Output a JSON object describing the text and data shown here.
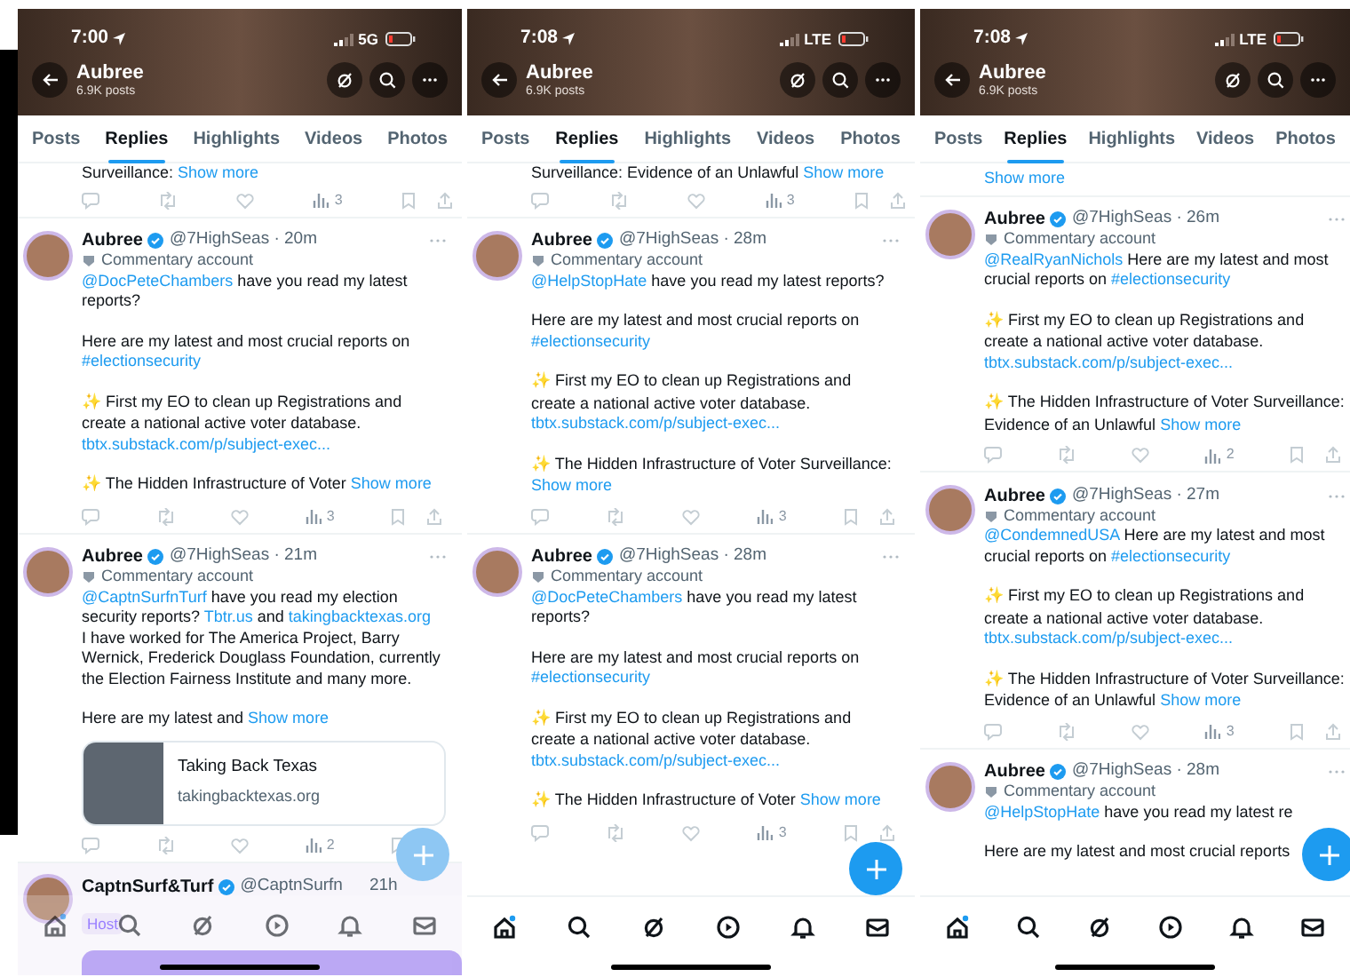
{
  "panels": [
    {
      "status": {
        "time": "7:00",
        "network": "5G"
      },
      "header": {
        "name": "Aubree",
        "posts": "6.9K posts"
      },
      "tabs": [
        {
          "label": "Posts",
          "selected": false
        },
        {
          "label": "Replies",
          "selected": true
        },
        {
          "label": "Highlights",
          "selected": false
        },
        {
          "label": "Videos",
          "selected": false
        },
        {
          "label": "Photos",
          "selected": false
        }
      ],
      "fragment": {
        "runs": [
          {
            "kind": "plain",
            "text": "Surveillance: "
          },
          {
            "kind": "more",
            "text": "Show more"
          }
        ],
        "views": "3"
      },
      "tweets": [
        {
          "name": "Aubree",
          "meta": "@7HighSeas · 20m",
          "label": "Commentary account",
          "paragraphs": [
            [
              {
                "kind": "mention",
                "text": "@DocPeteChambers"
              },
              {
                "kind": "plain",
                "text": " have you read my latest reports?"
              }
            ],
            [
              {
                "kind": "plain",
                "text": "Here are my latest and most crucial reports on "
              },
              {
                "kind": "hashtag",
                "text": "#electionsecurity"
              }
            ],
            [
              {
                "kind": "emoji",
                "text": "✨"
              },
              {
                "kind": "plain",
                "text": " First my EO to clean up Registrations and create a national active voter database. "
              },
              {
                "kind": "url",
                "text": "tbtx.substack.com/p/subject-exec..."
              }
            ],
            [
              {
                "kind": "emoji",
                "text": "✨"
              },
              {
                "kind": "plain",
                "text": " The Hidden Infrastructure of Voter "
              },
              {
                "kind": "more",
                "text": "Show more"
              }
            ]
          ],
          "views": "3"
        },
        {
          "name": "Aubree",
          "meta": "@7HighSeas · 21m",
          "label": "Commentary account",
          "paragraphs": [
            [
              {
                "kind": "mention",
                "text": "@CaptnSurfnTurf"
              },
              {
                "kind": "plain",
                "text": " have you read my election security reports? "
              },
              {
                "kind": "url",
                "text": "Tbtr.us"
              },
              {
                "kind": "plain",
                "text": " and "
              },
              {
                "kind": "url",
                "text": "takingbacktexas.org"
              },
              {
                "kind": "plain",
                "text": "\nI have worked for The America Project, Barry Wernick, Frederick Douglass Foundation, currently the Election Fairness Institute and many more."
              }
            ],
            [
              {
                "kind": "plain",
                "text": "Here are my latest and "
              },
              {
                "kind": "more",
                "text": "Show more"
              }
            ]
          ],
          "card": {
            "title": "Taking Back Texas",
            "domain": "takingbacktexas.org"
          },
          "views": "2"
        }
      ],
      "host_preview": {
        "name": "CaptnSurf&Turf",
        "meta": "@CaptnSurfn",
        "time": "21h",
        "badge": "Host"
      },
      "nav_translucent": true
    },
    {
      "status": {
        "time": "7:08",
        "network": "LTE"
      },
      "header": {
        "name": "Aubree",
        "posts": "6.9K posts"
      },
      "tabs": [
        {
          "label": "Posts",
          "selected": false
        },
        {
          "label": "Replies",
          "selected": true
        },
        {
          "label": "Highlights",
          "selected": false
        },
        {
          "label": "Videos",
          "selected": false
        },
        {
          "label": "Photos",
          "selected": false
        }
      ],
      "fragment": {
        "runs": [
          {
            "kind": "plain",
            "text": "Surveillance: Evidence of an Unlawful "
          },
          {
            "kind": "more",
            "text": "Show more"
          }
        ],
        "views": "3"
      },
      "tweets": [
        {
          "name": "Aubree",
          "meta": "@7HighSeas · 28m",
          "label": "Commentary account",
          "paragraphs": [
            [
              {
                "kind": "mention",
                "text": "@HelpStopHate"
              },
              {
                "kind": "plain",
                "text": " have you read my latest reports?"
              }
            ],
            [
              {
                "kind": "plain",
                "text": "Here are my latest and most crucial reports on "
              },
              {
                "kind": "hashtag",
                "text": "#electionsecurity"
              }
            ],
            [
              {
                "kind": "emoji",
                "text": "✨"
              },
              {
                "kind": "plain",
                "text": " First my EO to clean up Registrations and create a national active voter database. "
              },
              {
                "kind": "url",
                "text": "tbtx.substack.com/p/subject-exec..."
              }
            ],
            [
              {
                "kind": "emoji",
                "text": "✨"
              },
              {
                "kind": "plain",
                "text": " The Hidden Infrastructure of Voter Surveillance: "
              },
              {
                "kind": "more",
                "text": "Show more"
              }
            ]
          ],
          "views": "3"
        },
        {
          "name": "Aubree",
          "meta": "@7HighSeas · 28m",
          "label": "Commentary account",
          "paragraphs": [
            [
              {
                "kind": "mention",
                "text": "@DocPeteChambers"
              },
              {
                "kind": "plain",
                "text": " have you read my latest reports?"
              }
            ],
            [
              {
                "kind": "plain",
                "text": "Here are my latest and most crucial reports on "
              },
              {
                "kind": "hashtag",
                "text": "#electionsecurity"
              }
            ],
            [
              {
                "kind": "emoji",
                "text": "✨"
              },
              {
                "kind": "plain",
                "text": " First my EO to clean up Registrations and create a national active voter database. "
              },
              {
                "kind": "url",
                "text": "tbtx.substack.com/p/subject-exec..."
              }
            ],
            [
              {
                "kind": "emoji",
                "text": "✨"
              },
              {
                "kind": "plain",
                "text": " The Hidden Infrastructure of Voter "
              },
              {
                "kind": "more",
                "text": "Show more"
              }
            ]
          ],
          "views": "3"
        }
      ],
      "nav_translucent": false
    },
    {
      "status": {
        "time": "7:08",
        "network": "LTE"
      },
      "header": {
        "name": "Aubree",
        "posts": "6.9K posts"
      },
      "tabs": [
        {
          "label": "Posts",
          "selected": false
        },
        {
          "label": "Replies",
          "selected": true
        },
        {
          "label": "Highlights",
          "selected": false
        },
        {
          "label": "Videos",
          "selected": false
        },
        {
          "label": "Photos",
          "selected": false
        }
      ],
      "fragment": {
        "runs": [
          {
            "kind": "more",
            "text": "Show more"
          }
        ]
      },
      "tweets": [
        {
          "name": "Aubree",
          "meta": "@7HighSeas · 26m",
          "label": "Commentary account",
          "paragraphs": [
            [
              {
                "kind": "mention",
                "text": "@RealRyanNichols"
              },
              {
                "kind": "plain",
                "text": " Here are my latest and most crucial reports on "
              },
              {
                "kind": "hashtag",
                "text": "#electionsecurity"
              }
            ],
            [
              {
                "kind": "emoji",
                "text": "✨"
              },
              {
                "kind": "plain",
                "text": " First my EO to clean up Registrations and create a national active voter database. "
              },
              {
                "kind": "url",
                "text": "tbtx.substack.com/p/subject-exec..."
              }
            ],
            [
              {
                "kind": "emoji",
                "text": "✨"
              },
              {
                "kind": "plain",
                "text": " The Hidden Infrastructure of Voter Surveillance: Evidence of an Unlawful "
              },
              {
                "kind": "more",
                "text": "Show more"
              }
            ]
          ],
          "views": "2"
        },
        {
          "name": "Aubree",
          "meta": "@7HighSeas · 27m",
          "label": "Commentary account",
          "paragraphs": [
            [
              {
                "kind": "mention",
                "text": "@CondemnedUSA"
              },
              {
                "kind": "plain",
                "text": " Here are my latest and most crucial reports on "
              },
              {
                "kind": "hashtag",
                "text": "#electionsecurity"
              }
            ],
            [
              {
                "kind": "emoji",
                "text": "✨"
              },
              {
                "kind": "plain",
                "text": " First my EO to clean up Registrations and create a national active voter database. "
              },
              {
                "kind": "url",
                "text": "tbtx.substack.com/p/subject-exec..."
              }
            ],
            [
              {
                "kind": "emoji",
                "text": "✨"
              },
              {
                "kind": "plain",
                "text": " The Hidden Infrastructure of Voter Surveillance: Evidence of an Unlawful "
              },
              {
                "kind": "more",
                "text": "Show more"
              }
            ]
          ],
          "views": "3"
        },
        {
          "name": "Aubree",
          "meta": "@7HighSeas · 28m",
          "label": "Commentary account",
          "paragraphs": [
            [
              {
                "kind": "mention",
                "text": "@HelpStopHate"
              },
              {
                "kind": "plain",
                "text": " have you read my latest re"
              }
            ],
            [
              {
                "kind": "plain",
                "text": "Here are my latest and most crucial reports"
              }
            ]
          ]
        }
      ],
      "nav_translucent": false
    }
  ]
}
